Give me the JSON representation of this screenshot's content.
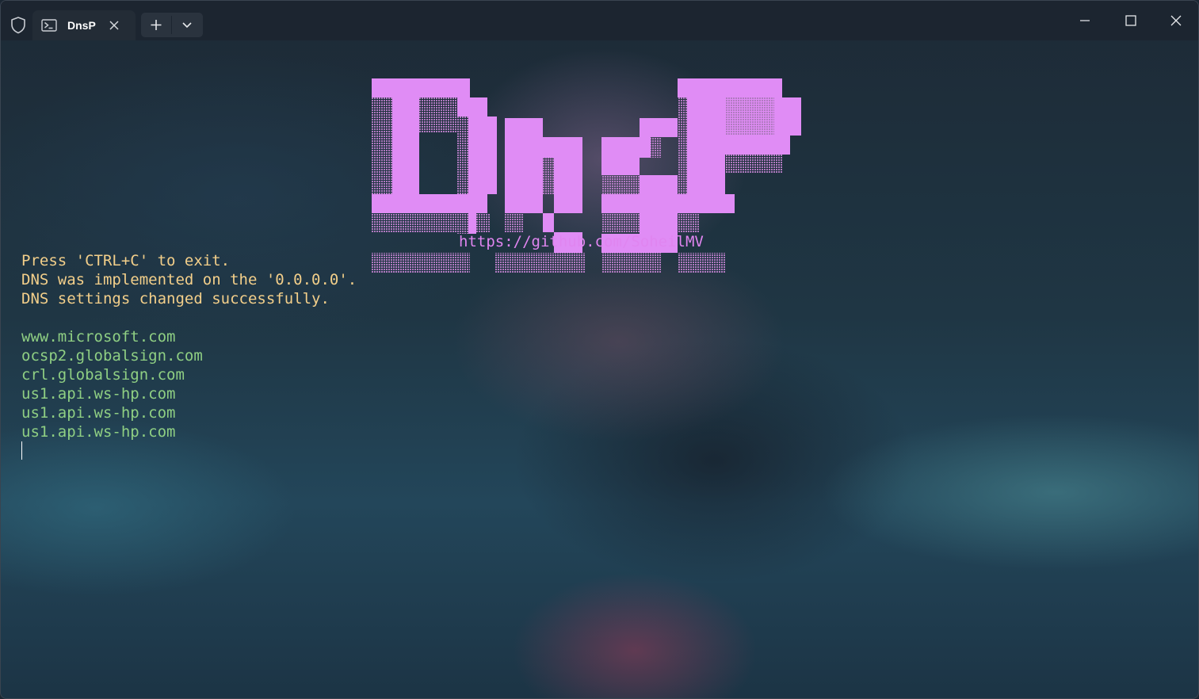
{
  "titlebar": {
    "tab_title": "DnsP"
  },
  "terminal": {
    "banner_text": "DnsP",
    "banner_url": "https://github.com/SoheilMV",
    "status_lines": [
      "Press 'CTRL+C' to exit.",
      "DNS was implemented on the '0.0.0.0'.",
      "DNS settings changed successfully."
    ],
    "domain_lines": [
      "www.microsoft.com",
      "ocsp2.globalsign.com",
      "crl.globalsign.com",
      "us1.api.ws-hp.com",
      "us1.api.ws-hp.com",
      "us1.api.ws-hp.com"
    ]
  },
  "colors": {
    "banner": "#e08cf5",
    "status_text": "#f3cf8a",
    "domain_text": "#8fcf83",
    "url_text": "#e085f0"
  },
  "icons": {
    "shield": "shield-icon",
    "tab": "powershell-icon",
    "close_tab": "close-icon",
    "new_tab": "plus-icon",
    "dropdown": "chevron-down-icon",
    "minimize": "minimize-icon",
    "maximize": "maximize-icon",
    "close_window": "close-icon"
  }
}
